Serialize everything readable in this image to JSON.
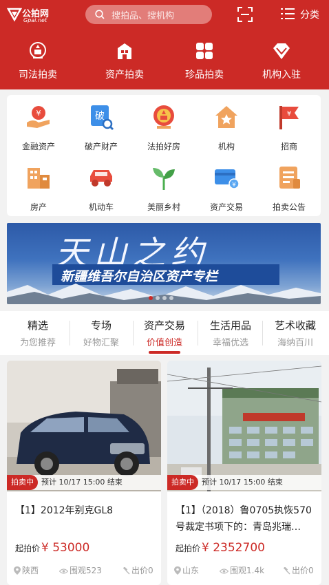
{
  "header": {
    "logo_text": "公拍网",
    "logo_domain": "Gpai.net",
    "search_placeholder": "搜拍品、搜机构",
    "category_label": "分类",
    "colors": {
      "brand_red": "#cc2a26"
    }
  },
  "top_nav": [
    {
      "label": "司法拍卖",
      "icon": "court-emblem-icon"
    },
    {
      "label": "资产拍卖",
      "icon": "building-icon"
    },
    {
      "label": "珍品拍卖",
      "icon": "grid-squares-icon"
    },
    {
      "label": "机构入驻",
      "icon": "diamond-icon"
    }
  ],
  "categories": [
    {
      "label": "金融资产",
      "icon": "money-hand-icon"
    },
    {
      "label": "破产财产",
      "icon": "bankruptcy-search-icon"
    },
    {
      "label": "法拍好房",
      "icon": "court-emblem-icon"
    },
    {
      "label": "机构",
      "icon": "house-star-icon"
    },
    {
      "label": "招商",
      "icon": "flag-icon"
    },
    {
      "label": "房产",
      "icon": "buildings-icon"
    },
    {
      "label": "机动车",
      "icon": "car-icon"
    },
    {
      "label": "美丽乡村",
      "icon": "sprout-icon"
    },
    {
      "label": "资产交易",
      "icon": "card-yen-icon"
    },
    {
      "label": "拍卖公告",
      "icon": "notice-icon"
    }
  ],
  "banner": {
    "title": "天山之约",
    "subtitle": "新疆维吾尔自治区资产专栏"
  },
  "tabs": [
    {
      "title": "精选",
      "subtitle": "为您推荐"
    },
    {
      "title": "专场",
      "subtitle": "好物汇聚"
    },
    {
      "title": "资产交易",
      "subtitle": "价值创造"
    },
    {
      "title": "生活用品",
      "subtitle": "幸福优选"
    },
    {
      "title": "艺术收藏",
      "subtitle": "海纳百川"
    }
  ],
  "cards": [
    {
      "badge": "拍卖中",
      "time": "预计 10/17 15:00 结束",
      "title": "【1】2012年别克GL8",
      "price_label": "起拍价",
      "price": "¥ 53000",
      "location": "陕西",
      "views": "围观523",
      "bids": "出价0"
    },
    {
      "badge": "拍卖中",
      "time": "预计 10/17 15:00 结束",
      "title": "【1】（2018）鲁0705执恢570号裁定书项下的：青岛兆瑞…",
      "price_label": "起拍价",
      "price": "¥ 2352700",
      "location": "山东",
      "views": "围观1.4k",
      "bids": "出价0"
    }
  ]
}
